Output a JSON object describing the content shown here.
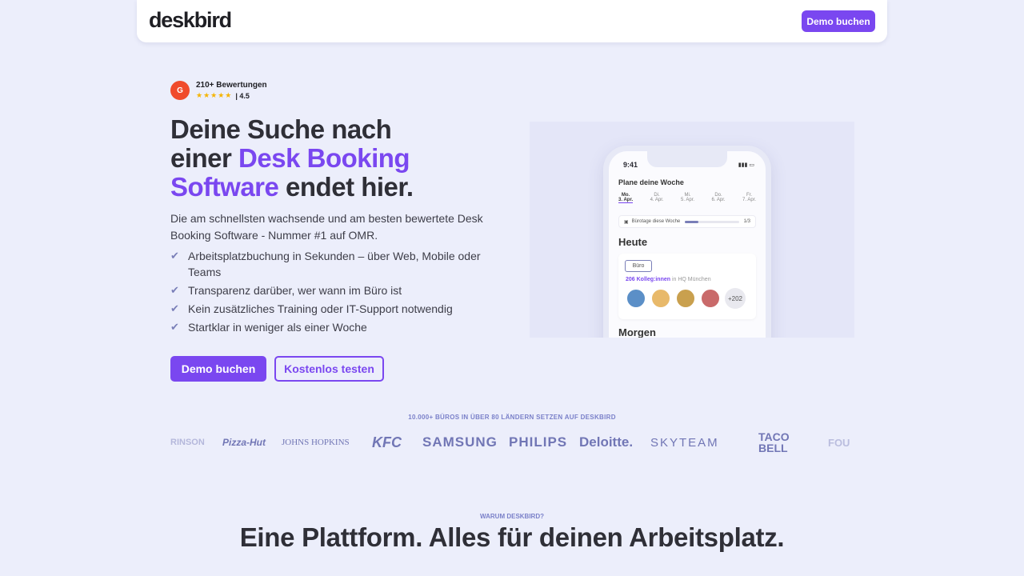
{
  "nav": {
    "logo": "deskbird",
    "demo_button": "Demo buchen"
  },
  "rating": {
    "g2_label": "G",
    "count": "210+ Bewertungen",
    "stars": "★★★★★",
    "score": "| 4.5"
  },
  "hero": {
    "headline_1": "Deine Suche nach",
    "headline_2a": "einer ",
    "headline_2b": "Desk Booking",
    "headline_3a": "Software",
    "headline_3b": " endet hier.",
    "subtext": "Die am schnellsten wachsende und am besten bewertete Desk Booking Software - Nummer #1 auf OMR.",
    "checklist": [
      "Arbeitsplatzbuchung in Sekunden – über Web, Mobile oder Teams",
      "Transparenz darüber, wer wann im Büro ist",
      "Kein zusätzliches Training oder IT-Support notwendig",
      "Startklar in weniger als einer Woche"
    ],
    "cta_primary": "Demo buchen",
    "cta_secondary": "Kostenlos testen"
  },
  "phone": {
    "time": "9:41",
    "signal": "▮▮▮ ▭",
    "title": "Plane deine Woche",
    "days": [
      {
        "name": "Mo.",
        "date": "3. Apr."
      },
      {
        "name": "Di.",
        "date": "4. Apr."
      },
      {
        "name": "Mi.",
        "date": "5. Apr."
      },
      {
        "name": "Do.",
        "date": "6. Apr."
      },
      {
        "name": "Fr.",
        "date": "7. Apr."
      }
    ],
    "bar_label": "Bürotage diese Woche",
    "bar_value": "1/3",
    "bar_fraction": 0.25,
    "today": "Heute",
    "tag": "Büro",
    "colleagues_bold": "206 Kolleg:innen",
    "colleagues_rest": " in HQ München",
    "more": "+202",
    "tomorrow": "Morgen",
    "avatar_colors": [
      "#5b8fc7",
      "#e8b96a",
      "#c9a04e",
      "#c96a6a"
    ]
  },
  "logos": {
    "title": "10.000+ BÜROS IN ÜBER 80 LÄNDERN SETZEN AUF DESKBIRD",
    "items": [
      "RINSON",
      "Pizza-Hut",
      "JOHNS HOPKINS",
      "KFC",
      "SAMSUNG",
      "PHILIPS",
      "Deloitte.",
      "SKYTEAM",
      "TACO BELL",
      "FOU"
    ]
  },
  "why": {
    "eyebrow": "WARUM DESKBIRD?",
    "title": "Eine Plattform. Alles für deinen Arbeitsplatz."
  }
}
